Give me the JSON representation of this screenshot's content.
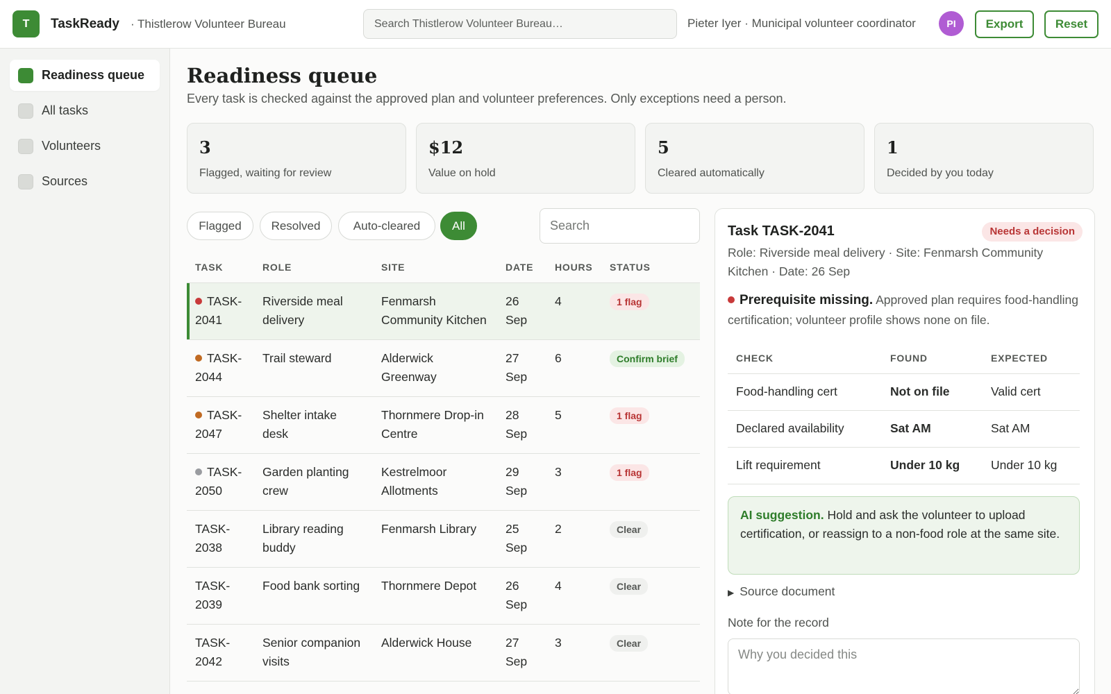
{
  "header": {
    "logo_letter": "T",
    "app_name": "TaskReady",
    "org": "· Thistlerow Volunteer Bureau",
    "search_placeholder": "Search Thistlerow Volunteer Bureau…",
    "user_line": "Pieter Iyer · Municipal volunteer coordinator",
    "avatar_initials": "PI",
    "export_label": "Export",
    "reset_label": "Reset"
  },
  "sidebar": {
    "items": [
      {
        "label": "Readiness queue",
        "active": true
      },
      {
        "label": "All tasks",
        "active": false
      },
      {
        "label": "Volunteers",
        "active": false
      },
      {
        "label": "Sources",
        "active": false
      }
    ]
  },
  "main": {
    "title": "Readiness queue",
    "subtitle": "Every task is checked against the approved plan and volunteer preferences. Only exceptions need a person.",
    "stats": [
      {
        "value": "3",
        "label": "Flagged, waiting for review"
      },
      {
        "value": "$12",
        "label": "Value on hold"
      },
      {
        "value": "5",
        "label": "Cleared automatically"
      },
      {
        "value": "1",
        "label": "Decided by you today"
      }
    ],
    "filters": [
      {
        "label": "Flagged",
        "active": false
      },
      {
        "label": "Resolved",
        "active": false
      },
      {
        "label": "Auto-cleared",
        "active": false
      },
      {
        "label": "All",
        "active": true
      }
    ],
    "search_placeholder": "Search",
    "table": {
      "headers": [
        "TASK",
        "ROLE",
        "SITE",
        "DATE",
        "HOURS",
        "STATUS"
      ],
      "rows": [
        {
          "id": "TASK-2041",
          "dot": "#c83a3a",
          "role": "Riverside meal delivery",
          "site": "Fenmarsh Community Kitchen",
          "date": "26 Sep",
          "hours": "4",
          "status": "1 flag",
          "status_kind": "flag",
          "selected": true
        },
        {
          "id": "TASK-2044",
          "dot": "#c06a22",
          "role": "Trail steward",
          "site": "Alderwick Greenway",
          "date": "27 Sep",
          "hours": "6",
          "status": "Confirm brief",
          "status_kind": "brief",
          "selected": false
        },
        {
          "id": "TASK-2047",
          "dot": "#c06a22",
          "role": "Shelter intake desk",
          "site": "Thornmere Drop-in Centre",
          "date": "28 Sep",
          "hours": "5",
          "status": "1 flag",
          "status_kind": "flag",
          "selected": false
        },
        {
          "id": "TASK-2050",
          "dot": "#9a9ca0",
          "role": "Garden planting crew",
          "site": "Kestrelmoor Allotments",
          "date": "29 Sep",
          "hours": "3",
          "status": "1 flag",
          "status_kind": "flag",
          "selected": false
        },
        {
          "id": "TASK-2038",
          "dot": "",
          "role": "Library reading buddy",
          "site": "Fenmarsh Library",
          "date": "25 Sep",
          "hours": "2",
          "status": "Clear",
          "status_kind": "clear",
          "selected": false
        },
        {
          "id": "TASK-2039",
          "dot": "",
          "role": "Food bank sorting",
          "site": "Thornmere Depot",
          "date": "26 Sep",
          "hours": "4",
          "status": "Clear",
          "status_kind": "clear",
          "selected": false
        },
        {
          "id": "TASK-2042",
          "dot": "",
          "role": "Senior companion visits",
          "site": "Alderwick House",
          "date": "27 Sep",
          "hours": "3",
          "status": "Clear",
          "status_kind": "clear",
          "selected": false
        }
      ]
    }
  },
  "detail": {
    "title": "Task TASK-2041",
    "badge": "Needs a decision",
    "meta": "Role: Riverside meal delivery · Site: Fenmarsh Community Kitchen · Date: 26 Sep",
    "issue_title": "Prerequisite missing.",
    "issue_text": "Approved plan requires food-handling certification; volunteer profile shows none on file.",
    "checks": {
      "headers": [
        "CHECK",
        "FOUND",
        "EXPECTED"
      ],
      "rows": [
        {
          "check": "Food-handling cert",
          "found": "Not on file",
          "ok": false,
          "expected": "Valid cert"
        },
        {
          "check": "Declared availability",
          "found": "Sat AM",
          "ok": true,
          "expected": "Sat AM"
        },
        {
          "check": "Lift requirement",
          "found": "Under 10 kg",
          "ok": true,
          "expected": "Under 10 kg"
        }
      ]
    },
    "ai_label": "AI suggestion.",
    "ai_text": "Hold and ask the volunteer to upload certification, or reassign to a non-food role at the same site.",
    "source_label": "Source document",
    "note_label": "Note for the record",
    "note_placeholder": "Why you decided this"
  },
  "colors": {
    "accent": "#3d8b35",
    "flag": "#b83535",
    "avatar": "#b05cd3"
  }
}
